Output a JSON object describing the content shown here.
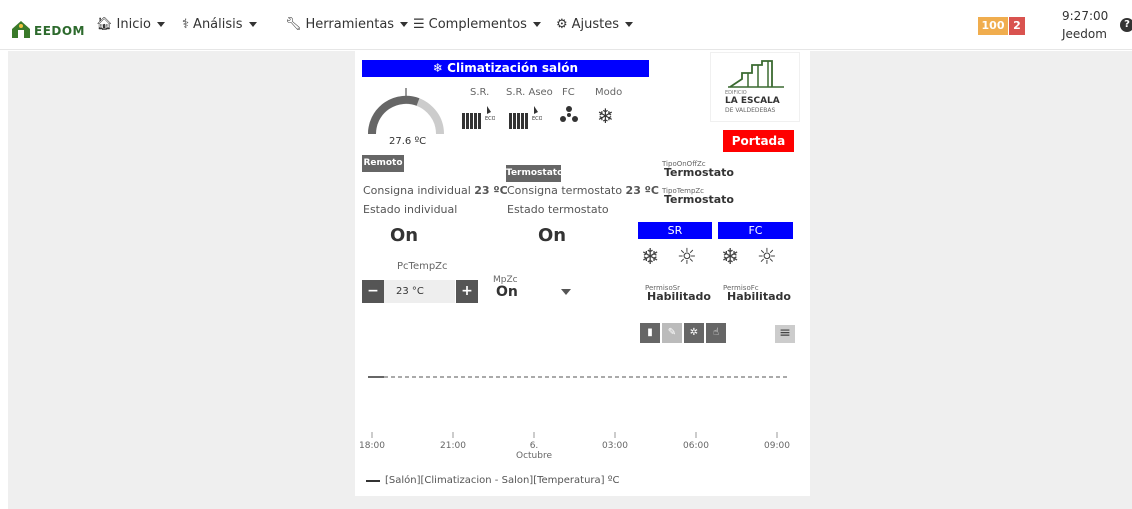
{
  "nav": {
    "brand": "EEDOM",
    "items": [
      {
        "icon": "home-icon",
        "glyph": "🏠︎",
        "label": "Inicio"
      },
      {
        "icon": "stethoscope-icon",
        "glyph": "⚕",
        "label": "Análisis"
      },
      {
        "icon": "wrench-icon",
        "glyph": "🔧︎",
        "label": "Herramientas"
      },
      {
        "icon": "list-icon",
        "glyph": "☰",
        "label": "Complementos"
      },
      {
        "icon": "cog-icon",
        "glyph": "⚙",
        "label": "Ajustes"
      }
    ],
    "badge_warning": "100",
    "badge_danger": "2",
    "time": "9:27:00",
    "user": "Jeedom",
    "help": "?"
  },
  "widget": {
    "title": "Climatización salón",
    "temperature": "27.6 ºC",
    "col_sr": "S.R.",
    "col_sr_aseo": "S.R. Aseo",
    "col_fc": "FC",
    "col_modo": "Modo",
    "remoto_btn": "Remoto",
    "termostato_btn": "Termostato",
    "consigna_individual_label": "Consigna individual",
    "consigna_individual_value": "23 ºC",
    "consigna_termostato_label": "Consigna termostato",
    "consigna_termostato_value": "23 ºC",
    "estado_individual_label": "Estado individual",
    "estado_individual_value": "On",
    "estado_termostato_label": "Estado termostato",
    "estado_termostato_value": "On",
    "pctempzc_label": "PcTempZc",
    "pctempzc_value": "23 °C",
    "minus": "−",
    "plus": "+",
    "mpzc_label": "MpZc",
    "mpzc_value": "On",
    "logo_small": "EDIFICIO",
    "logo_main": "LA ESCALA",
    "logo_sub": "DE VALDEDEBAS",
    "portada": "Portada",
    "tipo_onoff_label": "TipoOnOffZc",
    "tipo_onoff_value": "Termostato",
    "tipo_temp_label": "TipoTempZc",
    "tipo_temp_value": "Termostato",
    "sr_head": "SR",
    "fc_head": "FC",
    "permiso_sr_label": "PermisoSr",
    "permiso_sr_value": "HabilitadoFrío",
    "permiso_fc_label": "PermisoFc",
    "permiso_fc_value": "HabilitadoFrío"
  },
  "chart_data": {
    "type": "line",
    "x_ticks": [
      "18:00",
      "21:00",
      "6. Octubre",
      "03:00",
      "06:00",
      "09:00"
    ],
    "series": [
      {
        "name": "[Salón][Climatizacion - Salon][Temperatura] ºC",
        "values": []
      }
    ],
    "legend_position": "bottom-left",
    "grid": false
  }
}
